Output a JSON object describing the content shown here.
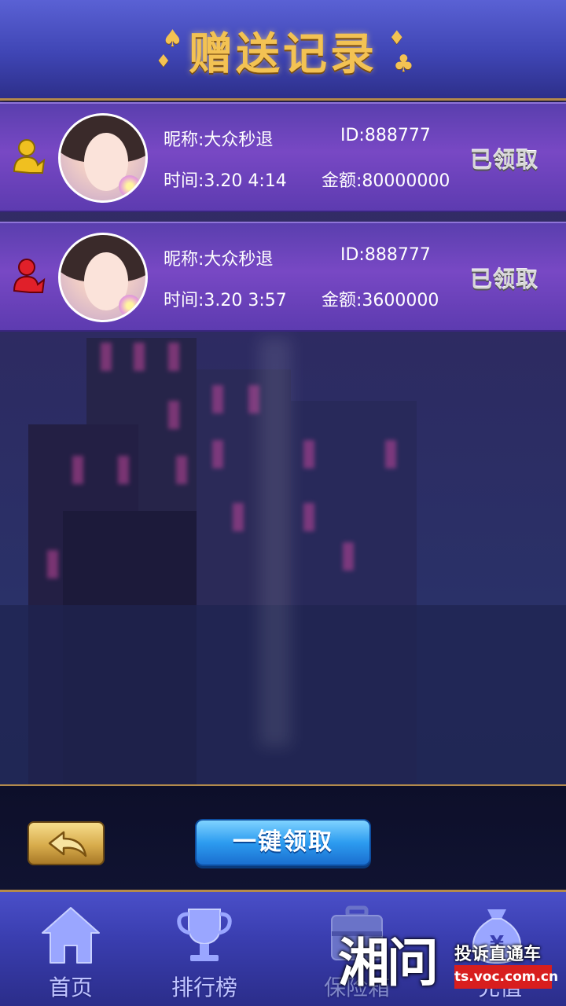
{
  "header": {
    "title": "赠送记录"
  },
  "records": [
    {
      "nickname": "昵称:大众秒退",
      "id": "ID:888777",
      "time": "时间:3.20  4:14",
      "amount": "金额:80000000",
      "status": "已领取",
      "user_icon_color": "#f0c020",
      "user_icon": "user-arrow-icon"
    },
    {
      "nickname": "昵称:大众秒退",
      "id": "ID:888777",
      "time": "时间:3.20  3:57",
      "amount": "金额:3600000",
      "status": "已领取",
      "user_icon_color": "#e0202a",
      "user_icon": "user-arrow-icon"
    }
  ],
  "actions": {
    "back_icon": "back-arrow-icon",
    "claim_all_label": "一键领取"
  },
  "nav": {
    "items": [
      {
        "label": "首页",
        "icon": "home-icon"
      },
      {
        "label": "排行榜",
        "icon": "trophy-icon"
      },
      {
        "label": "保险箱",
        "icon": "safe-icon"
      },
      {
        "label": "充值",
        "icon": "money-bag-icon"
      }
    ]
  },
  "watermark": {
    "logo": "湘问",
    "text": "投诉直通车",
    "url": "ts.voc.com.cn"
  },
  "colors": {
    "title_gold": "#f3c253",
    "record_purple": "#7848c4",
    "claim_button_blue": "#2d9cf0",
    "back_button_gold": "#d8ac4c",
    "nav_blue": "#3a3eb0"
  }
}
